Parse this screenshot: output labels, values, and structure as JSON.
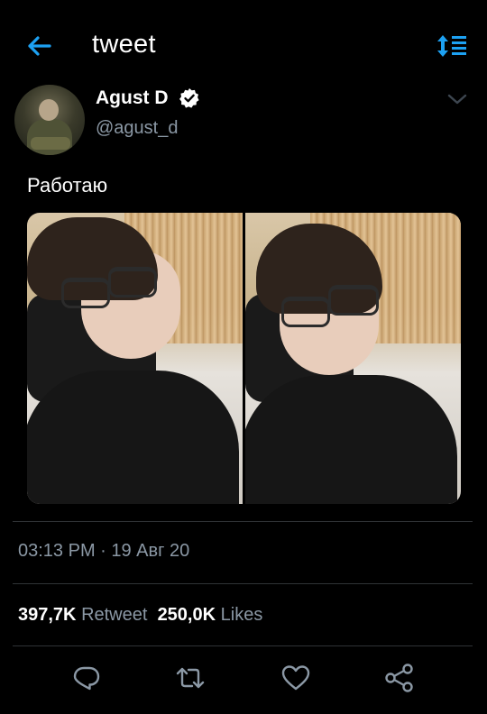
{
  "header": {
    "title": "tweet",
    "back_icon": "arrow-left-icon",
    "sort_icon": "sort-lines-icon",
    "accent": "#1da1f2"
  },
  "author": {
    "name": "Agust D",
    "handle": "@agust_d",
    "verified": true,
    "verified_icon": "verified-badge-icon"
  },
  "tweet": {
    "text": "Работаю",
    "media_count": 2
  },
  "meta": {
    "timestamp": "03:13 PM · 19 Авг 20"
  },
  "stats": {
    "retweet_count": "397,7K",
    "retweet_label": "Retweet",
    "like_count": "250,0K",
    "like_label": "Likes"
  },
  "actions": [
    {
      "name": "reply",
      "icon": "reply-bubble-icon"
    },
    {
      "name": "retweet",
      "icon": "retweet-icon"
    },
    {
      "name": "like",
      "icon": "heart-icon"
    },
    {
      "name": "share",
      "icon": "share-icon"
    }
  ],
  "colors": {
    "background": "#000000",
    "secondary_text": "#8b98a5",
    "divider": "#2f3336"
  }
}
